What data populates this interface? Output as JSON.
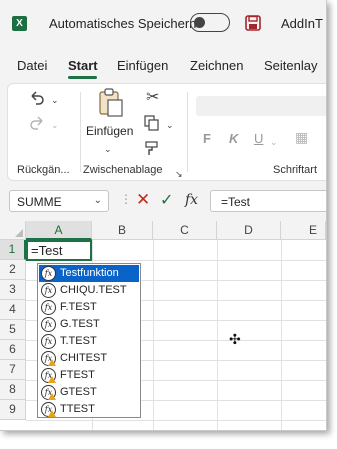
{
  "titlebar": {
    "app_icon": "excel-icon",
    "autosave_label": "Automatisches Speichern",
    "save_icon": "save-icon",
    "document_title": "AddInT"
  },
  "tabs": [
    "Datei",
    "Start",
    "Einfügen",
    "Zeichnen",
    "Seitenlay"
  ],
  "active_tab": "Start",
  "ribbon": {
    "groups": [
      {
        "label": "Rückgän..."
      },
      {
        "label": "Zwischenablage"
      },
      {
        "label": "Schriftart"
      }
    ],
    "paste_label": "Einfügen",
    "format_buttons": [
      "F",
      "K",
      "U"
    ]
  },
  "formula_bar": {
    "name_box": "SUMME",
    "fx_label": "fx",
    "formula": "=Test"
  },
  "grid": {
    "columns": [
      "A",
      "B",
      "C",
      "D",
      "E"
    ],
    "rows": [
      "1",
      "2",
      "3",
      "4",
      "5",
      "6",
      "7",
      "8",
      "9"
    ],
    "active_cell_value": "=Test"
  },
  "autocomplete": {
    "items": [
      {
        "label": "Testfunktion",
        "warning": false
      },
      {
        "label": "CHIQU.TEST",
        "warning": false
      },
      {
        "label": "F.TEST",
        "warning": false
      },
      {
        "label": "G.TEST",
        "warning": false
      },
      {
        "label": "T.TEST",
        "warning": false
      },
      {
        "label": "CHITEST",
        "warning": true
      },
      {
        "label": "FTEST",
        "warning": true
      },
      {
        "label": "GTEST",
        "warning": true
      },
      {
        "label": "TTEST",
        "warning": true
      }
    ],
    "selected_index": 0
  },
  "colors": {
    "accent": "#1e7145",
    "selection": "#0a63c9",
    "warning": "#e8a317"
  }
}
